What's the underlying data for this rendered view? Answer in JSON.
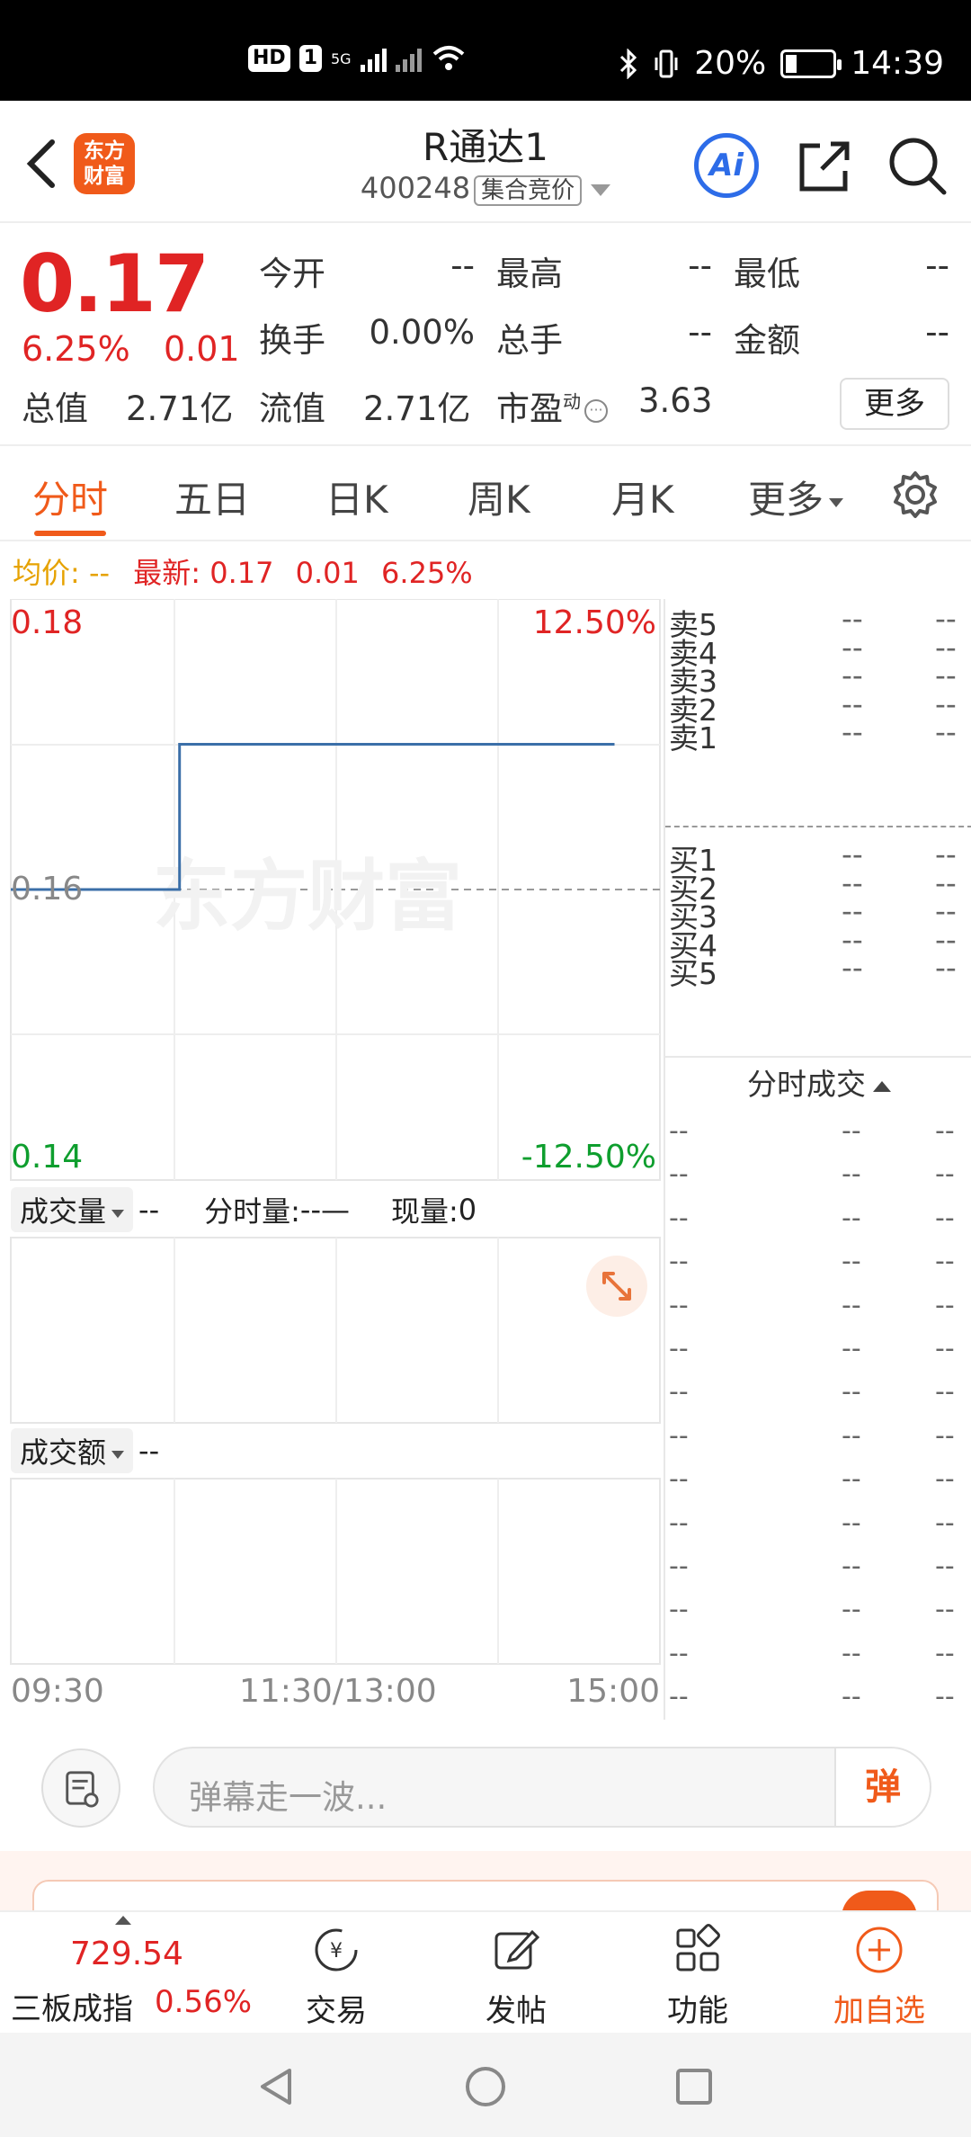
{
  "status_bar": {
    "network_badge": "HD",
    "sim_badge": "1",
    "network_type": "5G",
    "battery": "20%",
    "time": "14:39"
  },
  "header": {
    "logo_line1": "东方",
    "logo_line2": "财富",
    "title": "R通达1",
    "code": "400248",
    "auction_tag": "集合竞价",
    "ai_label": "Ai"
  },
  "quote": {
    "price": "0.17",
    "change_pct": "6.25%",
    "change": "0.01",
    "open_label": "今开",
    "open_value": "--",
    "high_label": "最高",
    "high_value": "--",
    "low_label": "最低",
    "low_value": "--",
    "turnover_label": "换手",
    "turnover_value": "0.00%",
    "volume_label": "总手",
    "volume_value": "--",
    "amount_label": "金额",
    "amount_value": "--",
    "mktcap_label": "总值",
    "mktcap_value": "2.71亿",
    "float_label": "流值",
    "float_value": "2.71亿",
    "pe_label": "市盈",
    "pe_sup": "动",
    "pe_value": "3.63",
    "more_label": "更多"
  },
  "tabs": [
    "分时",
    "五日",
    "日K",
    "周K",
    "月K",
    "更多"
  ],
  "info_line": {
    "avg_label": "均价:",
    "avg_value": "--",
    "latest_label": "最新:",
    "latest_price": "0.17",
    "latest_change": "0.01",
    "latest_pct": "6.25%"
  },
  "chart": {
    "y_top": "0.18",
    "y_mid": "0.16",
    "y_bottom": "0.14",
    "pct_top": "12.50%",
    "pct_bottom": "-12.50%",
    "watermark": "东方财富",
    "x_start": "09:30",
    "x_mid": "11:30/13:00",
    "x_end": "15:00",
    "colors": {
      "line": "#3b6fa8",
      "up": "#e02424",
      "down": "#0e9e2e"
    }
  },
  "chart_data": {
    "type": "line",
    "title": "",
    "x_ticks": [
      "09:30",
      "11:30/13:00",
      "15:00"
    ],
    "ylim": [
      0.14,
      0.18
    ],
    "y_ticks": [
      "0.18",
      "0.16",
      "0.14"
    ],
    "pct_ticks": [
      "12.50%",
      "-12.50%"
    ],
    "reference_line": 0.16,
    "series": [
      {
        "x": [
          0,
          0.26,
          0.26,
          0.93
        ],
        "values": [
          0.16,
          0.16,
          0.17,
          0.17
        ]
      }
    ]
  },
  "volume": {
    "selector": "成交量",
    "value": "--",
    "tick_label": "分时量:",
    "tick_value": "--—",
    "now_label": "现量:",
    "now_value": "0"
  },
  "amount": {
    "selector": "成交额",
    "value": "--"
  },
  "order_book": {
    "asks": [
      {
        "label": "卖5",
        "price": "--",
        "vol": "--"
      },
      {
        "label": "卖4",
        "price": "--",
        "vol": "--"
      },
      {
        "label": "卖3",
        "price": "--",
        "vol": "--"
      },
      {
        "label": "卖2",
        "price": "--",
        "vol": "--"
      },
      {
        "label": "卖1",
        "price": "--",
        "vol": "--"
      }
    ],
    "bids": [
      {
        "label": "买1",
        "price": "--",
        "vol": "--"
      },
      {
        "label": "买2",
        "price": "--",
        "vol": "--"
      },
      {
        "label": "买3",
        "price": "--",
        "vol": "--"
      },
      {
        "label": "买4",
        "price": "--",
        "vol": "--"
      },
      {
        "label": "买5",
        "price": "--",
        "vol": "--"
      }
    ],
    "trades_header": "分时成交",
    "trades": [
      [
        "--",
        "--",
        "--"
      ],
      [
        "--",
        "--",
        "--"
      ],
      [
        "--",
        "--",
        "--"
      ],
      [
        "--",
        "--",
        "--"
      ],
      [
        "--",
        "--",
        "--"
      ],
      [
        "--",
        "--",
        "--"
      ],
      [
        "--",
        "--",
        "--"
      ],
      [
        "--",
        "--",
        "--"
      ],
      [
        "--",
        "--",
        "--"
      ],
      [
        "--",
        "--",
        "--"
      ],
      [
        "--",
        "--",
        "--"
      ],
      [
        "--",
        "--",
        "--"
      ],
      [
        "--",
        "--",
        "--"
      ],
      [
        "--",
        "--",
        "--"
      ]
    ]
  },
  "comment": {
    "placeholder": "弹幕走一波...",
    "danmu_label": "弹"
  },
  "bottom_nav": {
    "index_value": "729.54",
    "index_name": "三板成指",
    "index_pct": "0.56%",
    "items": [
      "交易",
      "发帖",
      "功能",
      "加自选"
    ]
  }
}
